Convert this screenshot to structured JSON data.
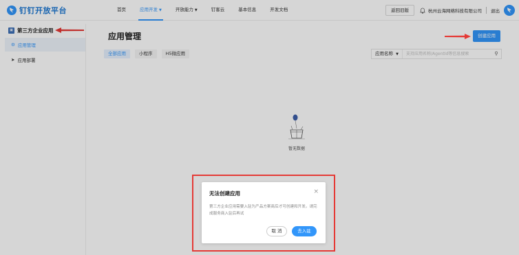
{
  "header": {
    "logo_text": "钉钉开放平台",
    "nav": [
      {
        "label": "首页"
      },
      {
        "label": "应用开发"
      },
      {
        "label": "开放能力"
      },
      {
        "label": "钉客云"
      },
      {
        "label": "基本信息"
      },
      {
        "label": "开发文档"
      }
    ],
    "old_version_label": "返回旧版",
    "company": "杭州云海网络科技有限公司",
    "logout": "退出",
    "accent_color": "#3296fa"
  },
  "sidebar": {
    "title": "第三方企业应用",
    "items": [
      {
        "label": "应用管理",
        "icon": "gear-icon",
        "active": true
      },
      {
        "label": "应用部署",
        "icon": "deploy-icon",
        "active": false
      }
    ]
  },
  "main": {
    "title": "应用管理",
    "create_button": "创建应用",
    "tabs": [
      {
        "label": "全部应用",
        "active": true
      },
      {
        "label": "小程序",
        "active": false
      },
      {
        "label": "H5微应用",
        "active": false
      }
    ],
    "search": {
      "select_label": "应用名称",
      "placeholder": "支持应用名称/AgentId等信息搜索"
    },
    "empty_text": "暂无数据"
  },
  "modal": {
    "title": "无法创建应用",
    "body": "第三方企业应用需要入驻为产品方案商后才可创建和开发。请完成服务商入驻后再试",
    "cancel_label": "取 消",
    "ok_label": "去入驻"
  },
  "annotation_color": "#e53935"
}
